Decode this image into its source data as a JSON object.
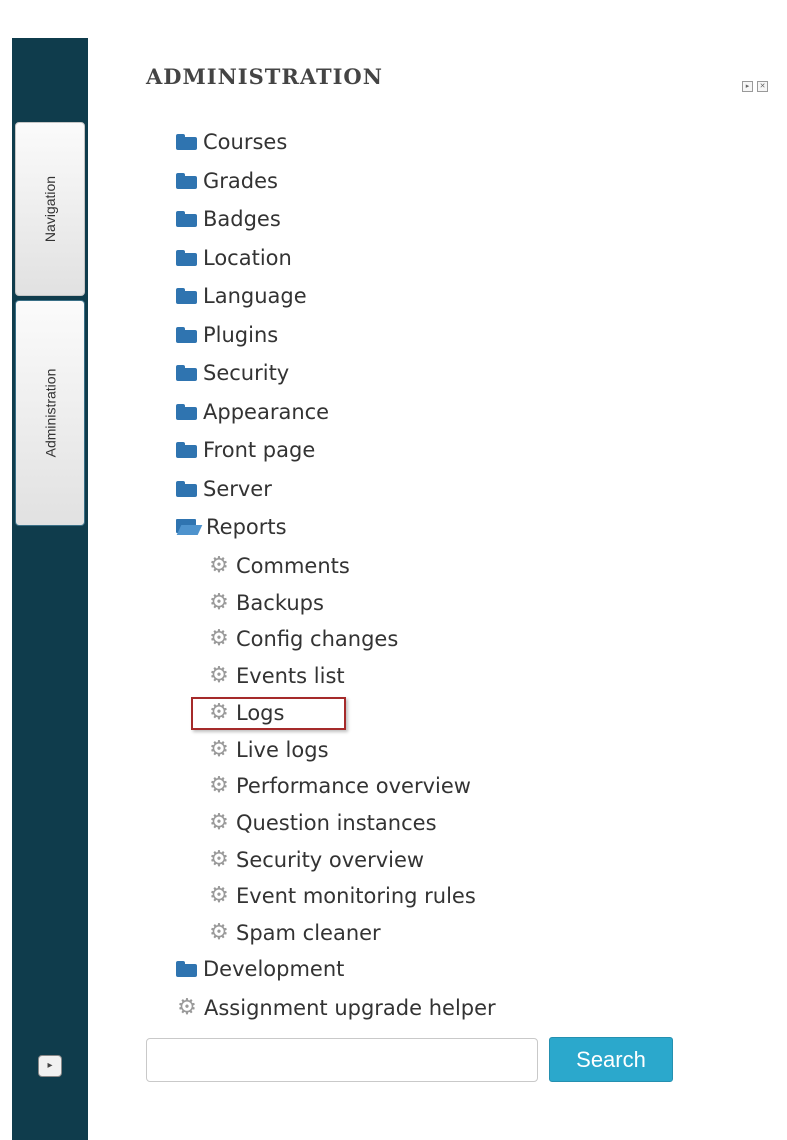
{
  "block": {
    "title": "ADMINISTRATION",
    "dock_icon": "dock-icon",
    "close_icon": "close-icon"
  },
  "sidebar": {
    "tabs": [
      {
        "label": "Navigation"
      },
      {
        "label": "Administration"
      }
    ],
    "dock_icon": "dock-icon"
  },
  "tree": {
    "categories": [
      {
        "label": "Courses",
        "icon": "folder-icon"
      },
      {
        "label": "Grades",
        "icon": "folder-icon"
      },
      {
        "label": "Badges",
        "icon": "folder-icon"
      },
      {
        "label": "Location",
        "icon": "folder-icon"
      },
      {
        "label": "Language",
        "icon": "folder-icon"
      },
      {
        "label": "Plugins",
        "icon": "folder-icon"
      },
      {
        "label": "Security",
        "icon": "folder-icon"
      },
      {
        "label": "Appearance",
        "icon": "folder-icon"
      },
      {
        "label": "Front page",
        "icon": "folder-icon"
      },
      {
        "label": "Server",
        "icon": "folder-icon"
      }
    ],
    "reports": {
      "label": "Reports",
      "icon": "folder-open-icon",
      "children": [
        {
          "label": "Comments"
        },
        {
          "label": "Backups"
        },
        {
          "label": "Config changes"
        },
        {
          "label": "Events list"
        },
        {
          "label": "Logs",
          "highlighted": true
        },
        {
          "label": "Live logs"
        },
        {
          "label": "Performance overview"
        },
        {
          "label": "Question instances"
        },
        {
          "label": "Security overview"
        },
        {
          "label": "Event monitoring rules"
        },
        {
          "label": "Spam cleaner"
        }
      ]
    },
    "development": {
      "label": "Development",
      "icon": "folder-icon"
    },
    "assignment_helper": {
      "label": "Assignment upgrade helper",
      "icon": "gear-icon"
    }
  },
  "search": {
    "value": "",
    "placeholder": "",
    "button_label": "Search"
  },
  "colors": {
    "dark_bg": "#0f3c4c",
    "folder": "#2f74b0",
    "search_button": "#2ba8cc",
    "highlight_border": "#a52a2a"
  }
}
